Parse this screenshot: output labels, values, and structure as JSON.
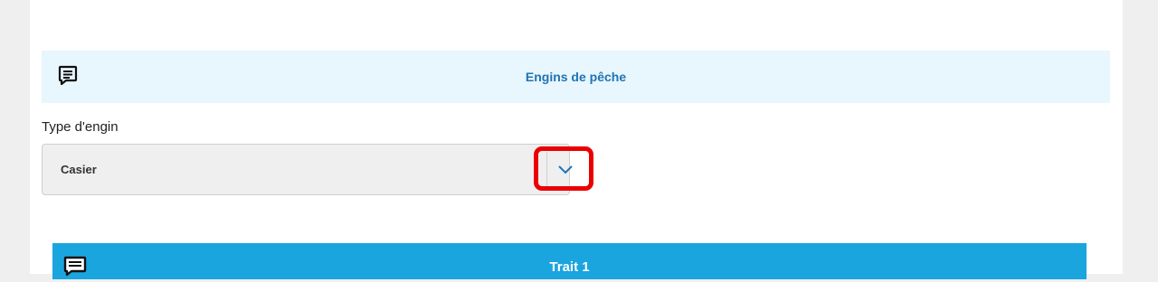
{
  "section": {
    "title": "Engins de pêche",
    "icon": "comment-icon"
  },
  "gear_type": {
    "label": "Type d'engin",
    "selected": "Casier",
    "dropdown_icon": "chevron-down-icon"
  },
  "trait": {
    "title": "Trait 1",
    "icon": "comment-icon"
  },
  "colors": {
    "header_bg": "#e8f6fd",
    "header_text": "#1f74b5",
    "trait_bg": "#1aa5df",
    "highlight": "#ea0000"
  }
}
